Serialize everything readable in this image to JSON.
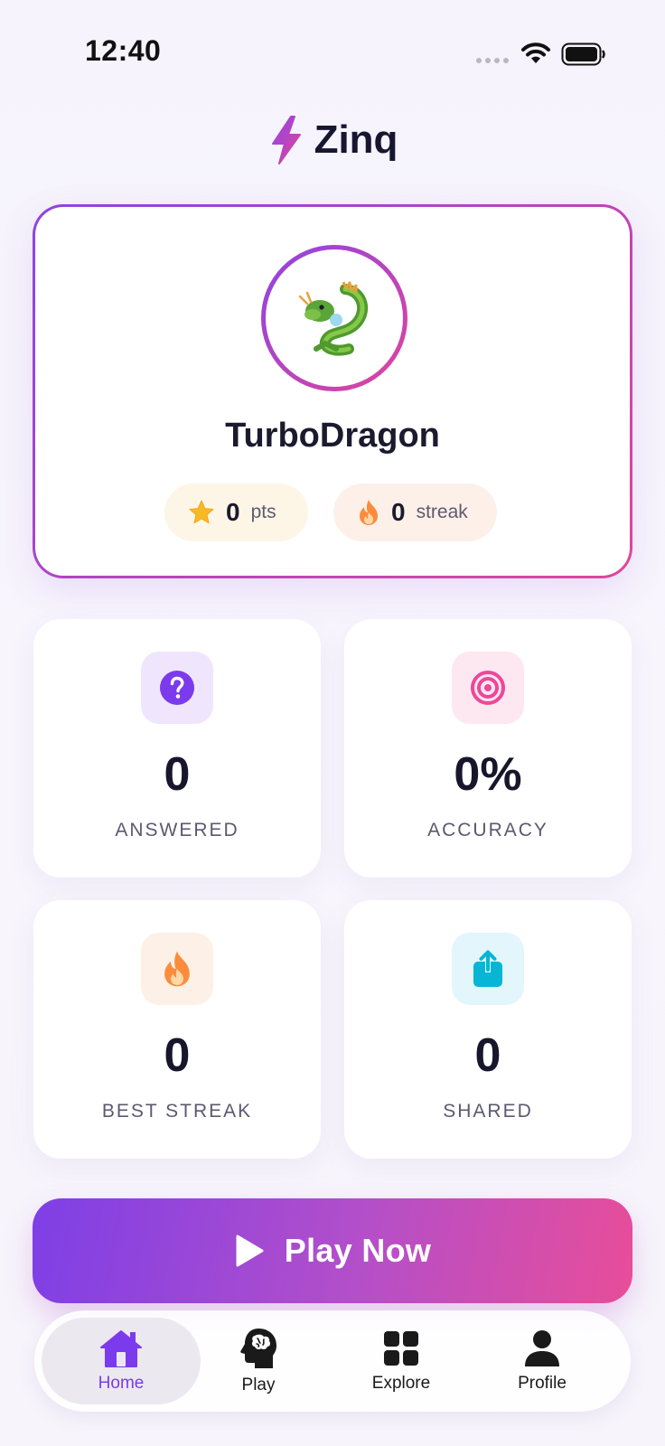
{
  "status_bar": {
    "time": "12:40"
  },
  "brand": {
    "name": "Zinq",
    "icon": "lightning-bolt-icon"
  },
  "profile": {
    "avatar_icon": "dragon-emoji",
    "username": "TurboDragon",
    "points_value": "0",
    "points_unit": "pts",
    "streak_value": "0",
    "streak_unit": "streak"
  },
  "stats": [
    {
      "value": "0",
      "label": "ANSWERED",
      "icon": "question-icon",
      "color": "#7c3aed"
    },
    {
      "value": "0%",
      "label": "ACCURACY",
      "icon": "target-icon",
      "color": "#ec4899"
    },
    {
      "value": "0",
      "label": "BEST STREAK",
      "icon": "flame-icon",
      "color": "#fb8c3c"
    },
    {
      "value": "0",
      "label": "SHARED",
      "icon": "share-icon",
      "color": "#06b6d4"
    }
  ],
  "play_button": {
    "label": "Play Now"
  },
  "tabs": [
    {
      "label": "Home",
      "icon": "house-icon",
      "active": true
    },
    {
      "label": "Play",
      "icon": "brain-head-icon",
      "active": false
    },
    {
      "label": "Explore",
      "icon": "grid-icon",
      "active": false
    },
    {
      "label": "Profile",
      "icon": "person-icon",
      "active": false
    }
  ],
  "colors": {
    "accent_purple": "#7c3aed",
    "accent_pink": "#e84d99",
    "text_dark": "#1b1a2e"
  }
}
